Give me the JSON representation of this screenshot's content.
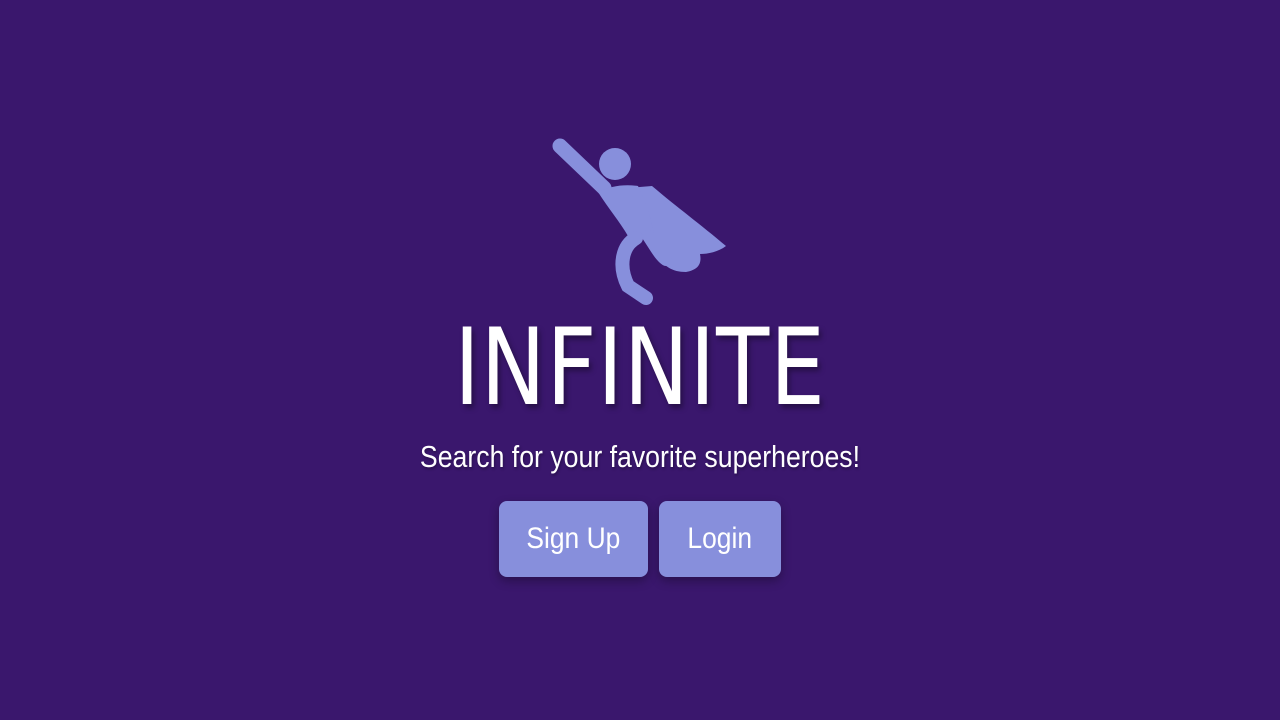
{
  "app": {
    "background_color": "#3a176d",
    "accent_color": "#878fdc"
  },
  "hero": {
    "icon": "flying-superhero-icon",
    "title": "INFINITE",
    "tagline": "Search for your favorite superheroes!"
  },
  "actions": {
    "signup_label": "Sign Up",
    "login_label": "Login"
  }
}
